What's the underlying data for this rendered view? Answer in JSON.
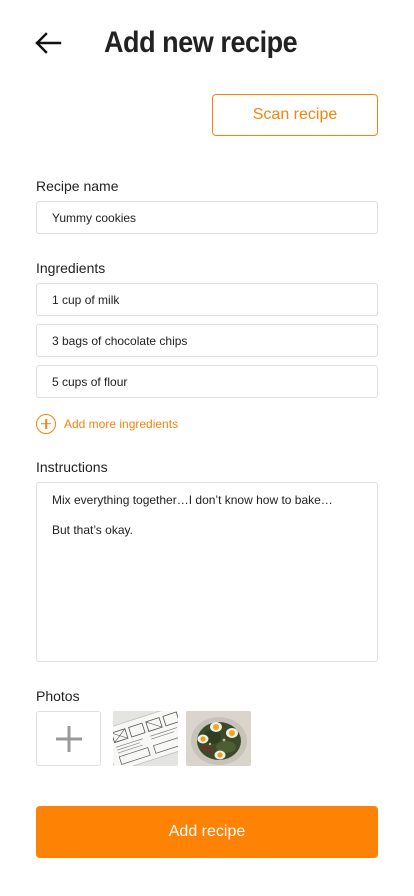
{
  "header": {
    "back_icon": "arrow-left-icon",
    "title": "Add new recipe"
  },
  "scan_button": {
    "label": "Scan recipe"
  },
  "recipe_name": {
    "label": "Recipe name",
    "value": "Yummy cookies"
  },
  "ingredients": {
    "label": "Ingredients",
    "items": [
      "1 cup of milk",
      "3 bags of chocolate chips",
      "5 cups of flour"
    ],
    "add_more_label": "Add more ingredients",
    "add_more_icon": "plus-circle-icon"
  },
  "instructions": {
    "label": "Instructions",
    "lines": [
      "Mix everything together…I don’t know how to bake…",
      "But that’s okay."
    ]
  },
  "photos": {
    "label": "Photos",
    "add_icon": "plus-icon",
    "thumbnails": [
      "wireframe-sketch-photo",
      "salad-with-eggs-photo"
    ]
  },
  "submit_button": {
    "label": "Add recipe"
  },
  "colors": {
    "accent": "#fe8204",
    "border": "#dedede",
    "text": "#222222"
  }
}
